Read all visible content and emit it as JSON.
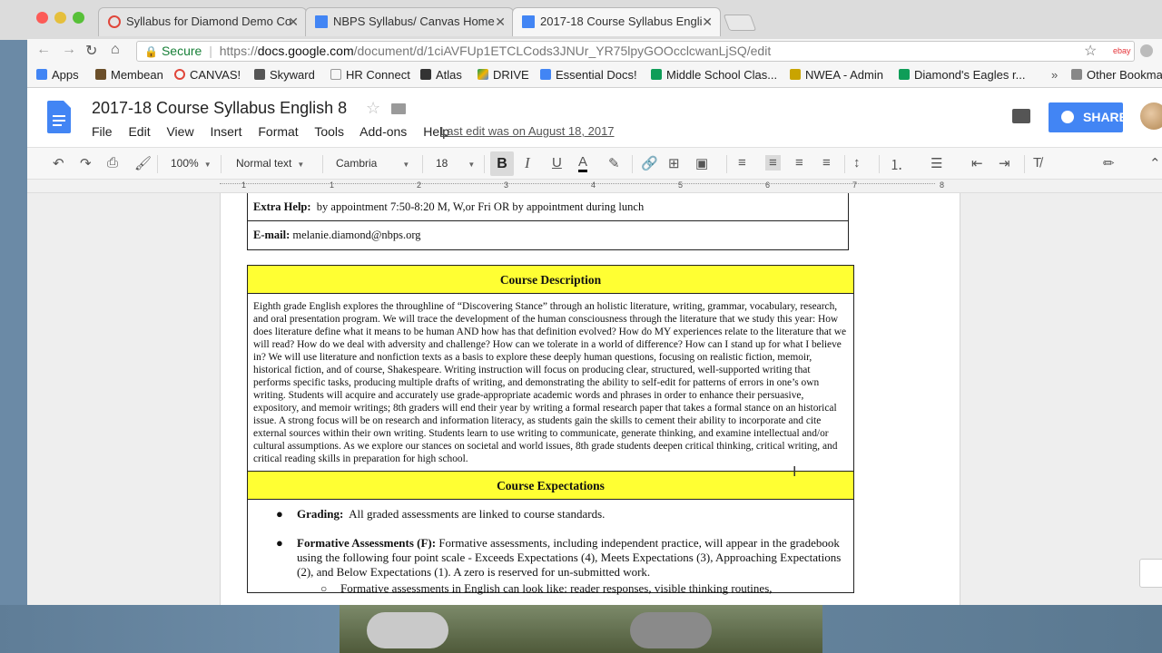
{
  "browser": {
    "tabs": [
      {
        "title": "Syllabus for Diamond Demo Co",
        "icon_color": "#e0463a"
      },
      {
        "title": "NBPS Syllabus/ Canvas Home",
        "icon_color": "#4285f4"
      },
      {
        "title": "2017-18 Course Syllabus Engli",
        "icon_color": "#4285f4"
      }
    ],
    "url": {
      "secure_label": "Secure",
      "scheme": "https://",
      "host": "docs.google.com",
      "path": "/document/d/1ciAVFUp1ETCLCods3JNUr_YR75lpyGOOcclcwanLjSQ/edit"
    },
    "bookmarks": [
      {
        "label": "Apps",
        "color": "#4285f4"
      },
      {
        "label": "Membean",
        "color": "#6b4f2a"
      },
      {
        "label": "CANVAS!",
        "color": "#e0463a"
      },
      {
        "label": "Skyward",
        "color": "#555555"
      },
      {
        "label": "HR Connect",
        "color": "#999999"
      },
      {
        "label": "Atlas",
        "color": "#333333"
      },
      {
        "label": "DRIVE",
        "color": "#f4b400"
      },
      {
        "label": "Essential Docs!",
        "color": "#4285f4"
      },
      {
        "label": "Middle School Clas...",
        "color": "#0f9d58"
      },
      {
        "label": "NWEA - Admin",
        "color": "#c9a400"
      },
      {
        "label": "Diamond's Eagles r...",
        "color": "#0f9d58"
      },
      {
        "label": "Other Bookmarks",
        "color": "#888888"
      }
    ]
  },
  "docs": {
    "title": "2017-18 Course Syllabus English 8",
    "menu": [
      "File",
      "Edit",
      "View",
      "Insert",
      "Format",
      "Tools",
      "Add-ons",
      "Help"
    ],
    "last_edit": "Last edit was on August 18, 2017",
    "share_label": "SHARE",
    "toolbar": {
      "zoom": "100%",
      "style": "Normal text",
      "font": "Cambria",
      "size": "18"
    },
    "ruler_numbers": [
      "1",
      "1",
      "2",
      "3",
      "4",
      "5",
      "6",
      "7",
      "8"
    ]
  },
  "content": {
    "extra_help_label": "Extra Help:",
    "extra_help_value": "by appointment 7:50-8:20 M, W,or Fri OR by appointment during lunch",
    "email_label": "E-mail:",
    "email_value": "melanie.diamond@nbps.org",
    "course_description_heading": "Course Description",
    "course_description_body": "Eighth grade English explores the throughline of “Discovering Stance” through an holistic literature, writing, grammar, vocabulary, research, and oral presentation program.   We will trace the development of the human consciousness through the literature that we study this year:  How does literature define what it means to be human AND how has that definition evolved? How do MY experiences relate to the literature that we will read?  How do we deal with adversity and challenge? How can we tolerate in a world of difference?  How can I stand up for what I believe in?   We will use literature and nonfiction texts as a basis to explore these deeply human questions, focusing on realistic fiction, memoir, historical fiction, and of course, Shakespeare. Writing instruction will focus on producing clear, structured, well-supported writing that performs specific tasks, producing multiple drafts of writing, and demonstrating the ability to self-edit for patterns of errors in one’s own writing.  Students will acquire and accurately use grade-appropriate academic words and phrases in order to enhance their persuasive, expository, and memoir writings; 8th graders will end their year by writing a formal research paper that takes a formal stance on an historical issue.  A strong focus will be on research and information literacy, as students gain the skills to cement their ability to incorporate and cite external sources within their own writing. Students learn to use writing to communicate, generate thinking, and examine intellectual and/or cultural assumptions.  As we explore our stances on societal and world issues, 8th grade students deepen critical thinking, critical writing, and critical reading skills in preparation for high school.",
    "course_expectations_heading": "Course Expectations",
    "grading_label": "Grading:",
    "grading_value": "All graded assessments are linked to course standards.",
    "formative_label": "Formative Assessments (F):",
    "formative_value": "Formative assessments, including independent practice, will appear in the gradebook using the following four point scale - Exceeds Expectations (4), Meets Expectations (3), Approaching Expectations (2), and Below Expectations (1).  A zero is reserved for un-submitted work.",
    "formative_sub": "Formative assessments in English can look like:  reader responses, visible thinking routines,"
  }
}
